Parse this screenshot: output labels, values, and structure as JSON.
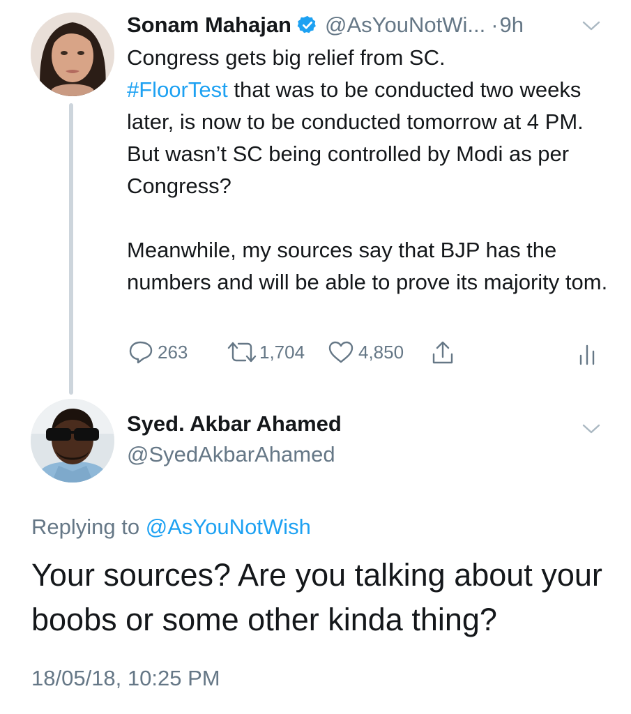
{
  "parent_tweet": {
    "display_name": "Sonam Mahajan",
    "handle": "@AsYouNotWi...",
    "separator": "·",
    "age": "9h",
    "text_line_1": "Congress gets big relief from SC.",
    "hashtag": "#FloorTest",
    "text_after_hashtag": " that was to be conducted two weeks later, is now to be conducted tomorrow at 4 PM. But wasn’t SC being controlled by Modi as per Congress?",
    "paragraph_2": "Meanwhile, my sources say that BJP has the numbers and will be able to prove its majority tom.",
    "actions": {
      "reply_count": "263",
      "retweet_count": "1,704",
      "like_count": "4,850"
    }
  },
  "reply_tweet": {
    "display_name": "Syed. Akbar Ahamed",
    "handle": "@SyedAkbarAhamed",
    "replying_to_label": "Replying to",
    "replying_to_handle": "@AsYouNotWish",
    "text": "Your sources? Are you talking about your boobs or some other kinda thing?",
    "timestamp": "18/05/18, 10:25 PM"
  },
  "icons": {
    "verified": "verified-badge-icon",
    "caret": "chevron-down-icon",
    "reply": "reply-icon",
    "retweet": "retweet-icon",
    "like": "heart-icon",
    "share": "share-icon",
    "analytics": "analytics-icon"
  },
  "colors": {
    "text": "#14171a",
    "secondary": "#657786",
    "link": "#1da1f2",
    "thread_line": "#cdd5dc"
  }
}
